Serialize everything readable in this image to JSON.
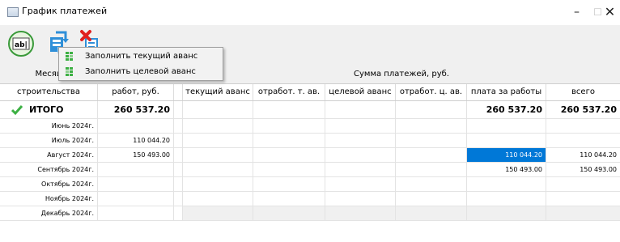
{
  "window": {
    "title": "График платежей",
    "min_glyph": "–",
    "max_glyph": "☐",
    "close_glyph": "✕"
  },
  "toolbar": {
    "buttons": [
      {
        "icon": "text-field-icon"
      },
      {
        "icon": "fill-icon"
      },
      {
        "icon": "clear-icon"
      }
    ],
    "text_icon_label": "ab|"
  },
  "context_menu": {
    "items": [
      {
        "label": "Заполнить текущий аванс",
        "icon": "grid-icon"
      },
      {
        "label": "Заполнить целевой аванс",
        "icon": "grid-icon"
      }
    ]
  },
  "header": {
    "month_group": "Месяц",
    "payments_group": "Сумма платежей, руб.",
    "columns": [
      "строительства",
      "работ, руб.",
      "текущий аванс",
      "отработ. т. ав.",
      "целевой аванс",
      "отработ. ц. ав.",
      "плата за работы",
      "всего"
    ]
  },
  "total": {
    "label": "ИТОГО",
    "work_cost": "260 537.20",
    "payment_for_work": "260 537.20",
    "total": "260 537.20"
  },
  "rows": [
    {
      "month": "Июнь 2024г.",
      "work_cost": "",
      "payment_for_work": "",
      "total": ""
    },
    {
      "month": "Июль 2024г.",
      "work_cost": "110 044.20",
      "payment_for_work": "",
      "total": ""
    },
    {
      "month": "Август 2024г.",
      "work_cost": "150 493.00",
      "payment_for_work": "110 044.20",
      "total": "110 044.20"
    },
    {
      "month": "Сентябрь 2024г.",
      "work_cost": "",
      "payment_for_work": "150 493.00",
      "total": "150 493.00"
    },
    {
      "month": "Октябрь 2024г.",
      "work_cost": "",
      "payment_for_work": "",
      "total": ""
    },
    {
      "month": "Ноябрь 2024г.",
      "work_cost": "",
      "payment_for_work": "",
      "total": ""
    },
    {
      "month": "Декабрь 2024г.",
      "work_cost": "",
      "payment_for_work": "",
      "total": ""
    }
  ],
  "colors": {
    "selection": "#0078d7",
    "check": "#3cb043",
    "toolbar_bg": "#f0f0f0"
  }
}
